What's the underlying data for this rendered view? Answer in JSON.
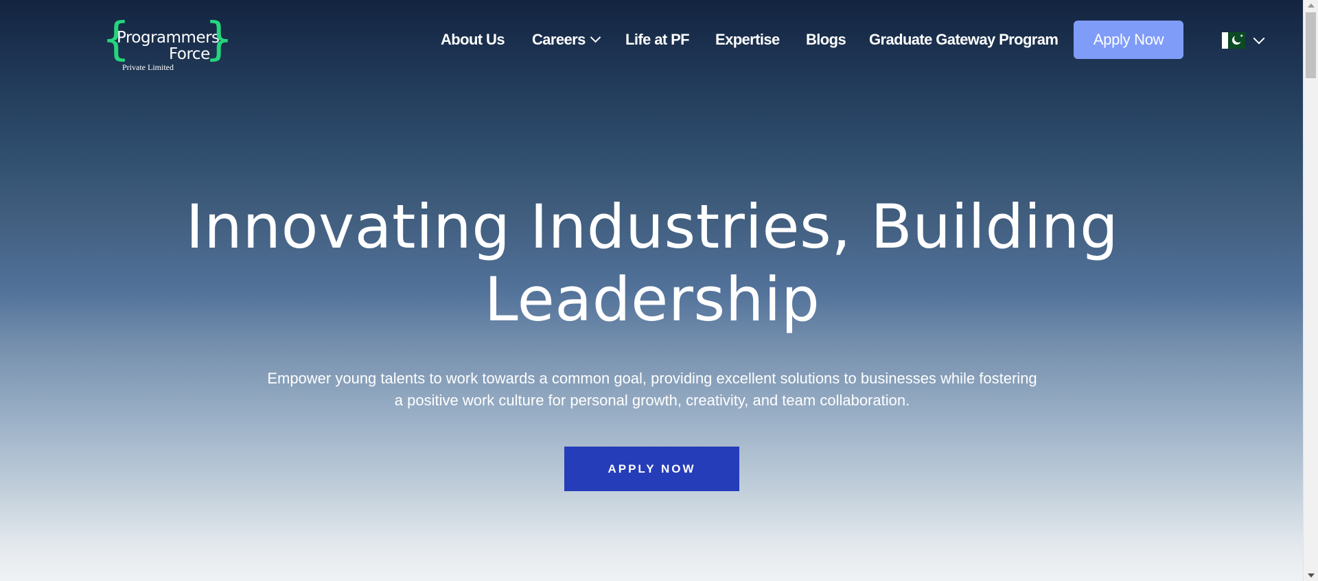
{
  "logo": {
    "line1": "Programmers",
    "line2": "Force",
    "line3": "Private Limited",
    "brace_left": "{",
    "brace_right": "}",
    "brace_color": "#24d67c"
  },
  "nav": {
    "items": [
      {
        "label": "About Us",
        "has_dropdown": false
      },
      {
        "label": "Careers",
        "has_dropdown": true
      },
      {
        "label": "Life at PF",
        "has_dropdown": false
      },
      {
        "label": "Expertise",
        "has_dropdown": false
      },
      {
        "label": "Blogs",
        "has_dropdown": false
      },
      {
        "label": "Graduate Gateway Program",
        "has_dropdown": false
      }
    ],
    "apply_button": {
      "label": "Apply Now",
      "color": "#7f9cf8"
    },
    "language": {
      "flag_icon": "pakistan-flag-icon",
      "dropdown_icon": "chevron-down-icon"
    }
  },
  "hero": {
    "title_line1": "Innovating Industries, Building",
    "title_line2": "Leadership",
    "description_line1": "Empower young talents to work towards a common goal, providing excellent solutions to businesses while fostering",
    "description_line2": "a positive work culture for personal growth, creativity, and team collaboration.",
    "cta_label": "APPLY NOW",
    "cta_color": "#253db9"
  },
  "colors": {
    "background_top": "#132440",
    "background_bottom": "#eff2f4"
  }
}
